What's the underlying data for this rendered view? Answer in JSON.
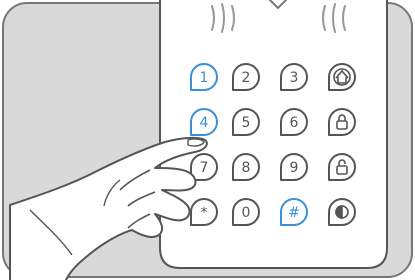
{
  "keypad": {
    "keys": [
      {
        "label": "1",
        "kind": "digit",
        "highlighted": true
      },
      {
        "label": "2",
        "kind": "digit",
        "highlighted": false
      },
      {
        "label": "3",
        "kind": "digit",
        "highlighted": false
      },
      {
        "label": "",
        "kind": "icon",
        "icon": "home-icon",
        "highlighted": false
      },
      {
        "label": "4",
        "kind": "digit",
        "highlighted": true
      },
      {
        "label": "5",
        "kind": "digit",
        "highlighted": false
      },
      {
        "label": "6",
        "kind": "digit",
        "highlighted": false
      },
      {
        "label": "",
        "kind": "icon",
        "icon": "lock-icon",
        "highlighted": false
      },
      {
        "label": "7",
        "kind": "digit",
        "highlighted": false
      },
      {
        "label": "8",
        "kind": "digit",
        "highlighted": false
      },
      {
        "label": "9",
        "kind": "digit",
        "highlighted": false
      },
      {
        "label": "",
        "kind": "icon",
        "icon": "unlock-icon",
        "highlighted": false
      },
      {
        "label": "*",
        "kind": "digit",
        "highlighted": false
      },
      {
        "label": "0",
        "kind": "digit",
        "highlighted": false
      },
      {
        "label": "#",
        "kind": "digit",
        "highlighted": true
      },
      {
        "label": "",
        "kind": "icon",
        "icon": "half-filled-circle-icon",
        "highlighted": false
      }
    ],
    "colors": {
      "highlight": "#3a8fd6",
      "normal": "#555555",
      "device_bg": "#ffffff",
      "background": "#d9d9d9",
      "frame_border": "#777777"
    }
  },
  "decor": {
    "wireless_icon": "wireless-signal-icon",
    "hand_icon": "pointing-hand-icon"
  }
}
